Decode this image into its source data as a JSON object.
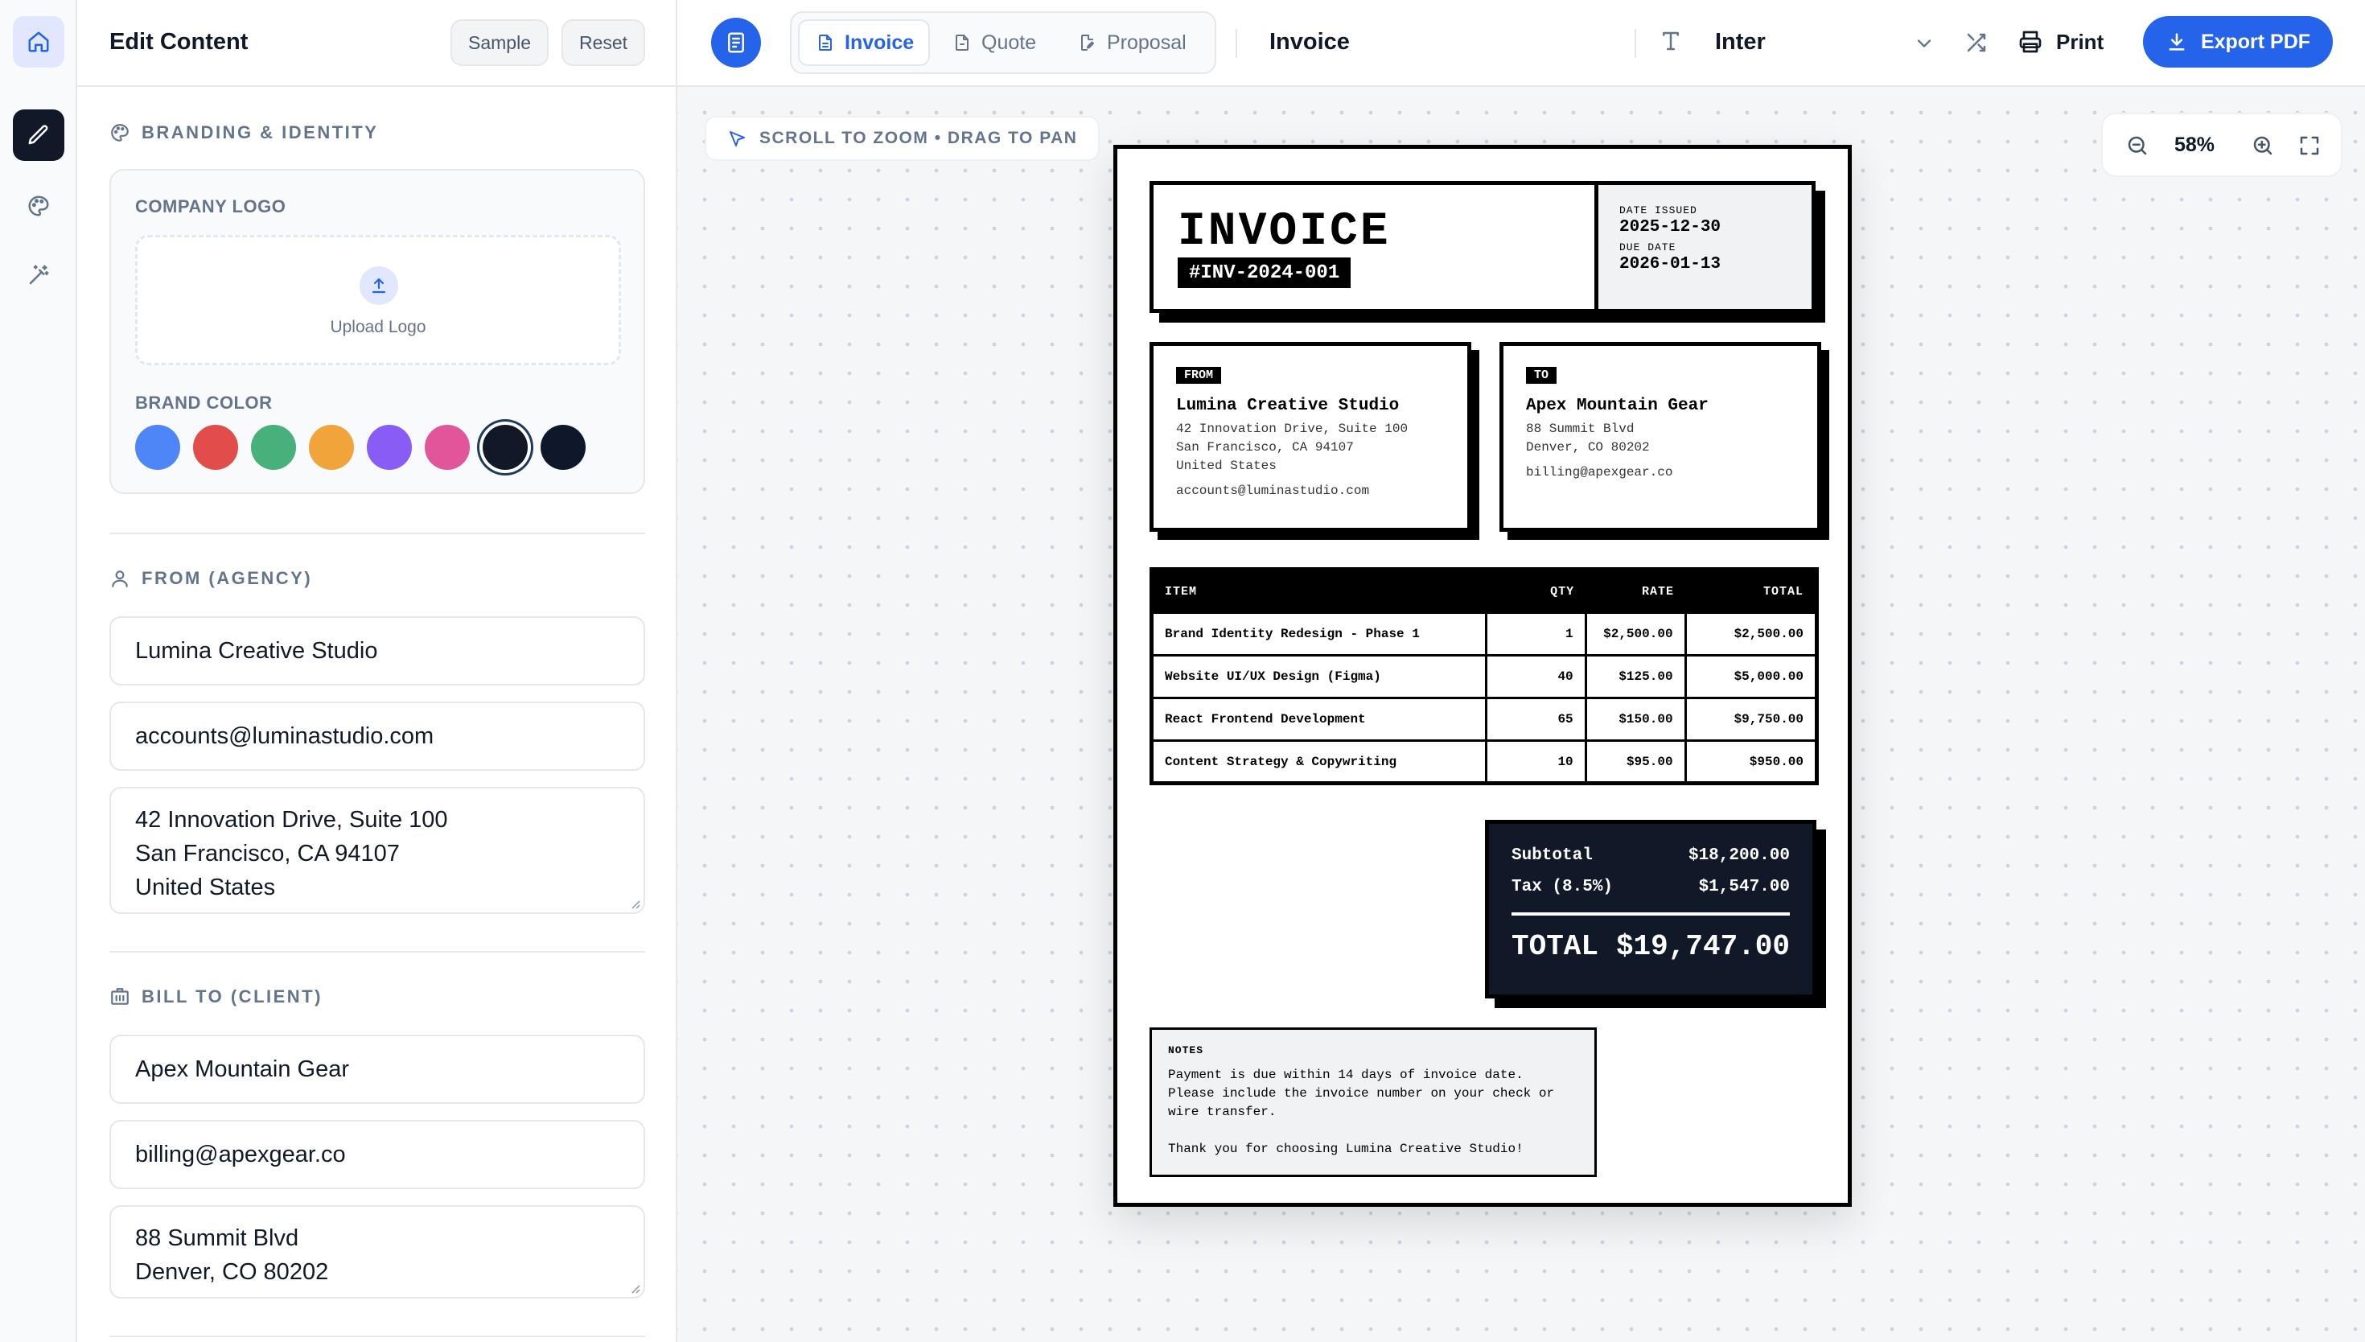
{
  "editor": {
    "title": "Edit Content",
    "sample_label": "Sample",
    "reset_label": "Reset",
    "branding": {
      "section_title": "BRANDING & IDENTITY",
      "logo_label": "COMPANY LOGO",
      "upload_label": "Upload Logo",
      "brand_color_label": "BRAND COLOR",
      "colors": [
        "#4f86f7",
        "#e24c4b",
        "#47b07b",
        "#f0a43a",
        "#8a5cf6",
        "#e2559a",
        "#111827",
        "#0f172a"
      ],
      "selected_color": "#111827"
    },
    "from": {
      "section_title": "FROM (AGENCY)",
      "name": "Lumina Creative Studio",
      "email": "accounts@luminastudio.com",
      "address": [
        "42 Innovation Drive, Suite 100",
        "San Francisco, CA 94107",
        "United States"
      ]
    },
    "bill_to": {
      "section_title": "BILL TO (CLIENT)",
      "name": "Apex Mountain Gear",
      "email": "billing@apexgear.co",
      "address": [
        "88 Summit Blvd",
        "Denver, CO 80202"
      ]
    }
  },
  "toolbar": {
    "tabs": [
      "Invoice",
      "Quote",
      "Proposal"
    ],
    "active_tab": "Invoice",
    "document_name": "Invoice",
    "font": "Inter",
    "print_label": "Print",
    "export_label": "Export PDF"
  },
  "canvas": {
    "hint": "SCROLL TO ZOOM • DRAG TO PAN",
    "zoom": "58%"
  },
  "invoice": {
    "title": "INVOICE",
    "number": "#INV-2024-001",
    "date_issued_label": "DATE ISSUED",
    "date_issued": "2025-12-30",
    "due_date_label": "DUE DATE",
    "due_date": "2026-01-13",
    "from": {
      "tag": "FROM",
      "name": "Lumina Creative Studio",
      "lines": [
        "42 Innovation Drive, Suite 100",
        "San Francisco, CA 94107",
        "United States"
      ],
      "email": "accounts@luminastudio.com"
    },
    "to": {
      "tag": "TO",
      "name": "Apex Mountain Gear",
      "lines": [
        "88 Summit Blvd",
        "Denver, CO 80202"
      ],
      "email": "billing@apexgear.co"
    },
    "columns": [
      "ITEM",
      "QTY",
      "RATE",
      "TOTAL"
    ],
    "items": [
      {
        "desc": "Brand Identity Redesign - Phase 1",
        "qty": "1",
        "rate": "$2,500.00",
        "total": "$2,500.00"
      },
      {
        "desc": "Website UI/UX Design (Figma)",
        "qty": "40",
        "rate": "$125.00",
        "total": "$5,000.00"
      },
      {
        "desc": "React Frontend Development",
        "qty": "65",
        "rate": "$150.00",
        "total": "$9,750.00"
      },
      {
        "desc": "Content Strategy & Copywriting",
        "qty": "10",
        "rate": "$95.00",
        "total": "$950.00"
      }
    ],
    "subtotal_label": "Subtotal",
    "subtotal": "$18,200.00",
    "tax_label": "Tax (8.5%)",
    "tax": "$1,547.00",
    "total_label": "TOTAL",
    "total": "$19,747.00",
    "notes_label": "NOTES",
    "notes": [
      "Payment is due within 14 days of invoice date.",
      "Please include the invoice number on your check or",
      "wire transfer."
    ],
    "thanks": "Thank you for choosing Lumina Creative Studio!"
  }
}
